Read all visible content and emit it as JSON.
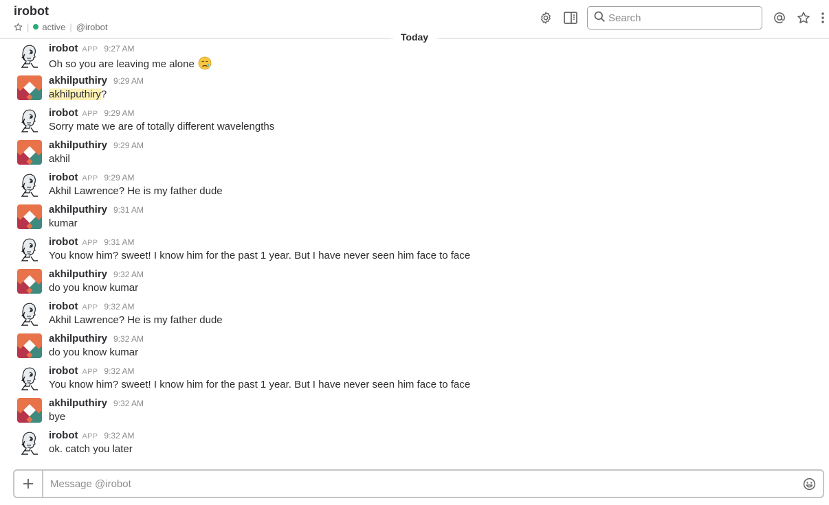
{
  "header": {
    "title": "irobot",
    "status": "active",
    "handle": "@irobot",
    "presence_color": "#2bac76"
  },
  "toolbar": {
    "search_placeholder": "Search",
    "icons": [
      "gear-icon",
      "sidebar-toggle-icon",
      "search-icon",
      "at-mention-icon",
      "star-icon",
      "more-vertical-icon"
    ]
  },
  "day_divider": "Today",
  "messages": [
    {
      "sender": "irobot",
      "badge": "APP",
      "time": "9:27 AM",
      "text": "Oh so you are leaving me alone",
      "emoji": "crying-face-icon"
    },
    {
      "sender": "akhilputhiry",
      "badge": "",
      "time": "9:29 AM",
      "mention": "akhilputhiry",
      "text": "?"
    },
    {
      "sender": "irobot",
      "badge": "APP",
      "time": "9:29 AM",
      "text": "Sorry mate we are of totally different wavelengths"
    },
    {
      "sender": "akhilputhiry",
      "badge": "",
      "time": "9:29 AM",
      "text": "akhil"
    },
    {
      "sender": "irobot",
      "badge": "APP",
      "time": "9:29 AM",
      "text": "Akhil Lawrence? He is my father dude"
    },
    {
      "sender": "akhilputhiry",
      "badge": "",
      "time": "9:31 AM",
      "text": "kumar"
    },
    {
      "sender": "irobot",
      "badge": "APP",
      "time": "9:31 AM",
      "text": "You know him? sweet! I know him for the past 1 year. But I have never seen him face to face"
    },
    {
      "sender": "akhilputhiry",
      "badge": "",
      "time": "9:32 AM",
      "text": "do you know kumar"
    },
    {
      "sender": "irobot",
      "badge": "APP",
      "time": "9:32 AM",
      "text": "Akhil Lawrence? He is my father dude"
    },
    {
      "sender": "akhilputhiry",
      "badge": "",
      "time": "9:32 AM",
      "text": "do you know kumar"
    },
    {
      "sender": "irobot",
      "badge": "APP",
      "time": "9:32 AM",
      "text": "You know him? sweet! I know him for the past 1 year. But I have never seen him face to face"
    },
    {
      "sender": "akhilputhiry",
      "badge": "",
      "time": "9:32 AM",
      "text": "bye"
    },
    {
      "sender": "irobot",
      "badge": "APP",
      "time": "9:32 AM",
      "text": "ok. catch you later"
    }
  ],
  "composer": {
    "placeholder": "Message @irobot"
  },
  "colors": {
    "mention_highlight": "#fdf0b5",
    "avatar_orange": "#e8734a",
    "avatar_red": "#b8344a",
    "avatar_teal": "#3e8a7e"
  }
}
